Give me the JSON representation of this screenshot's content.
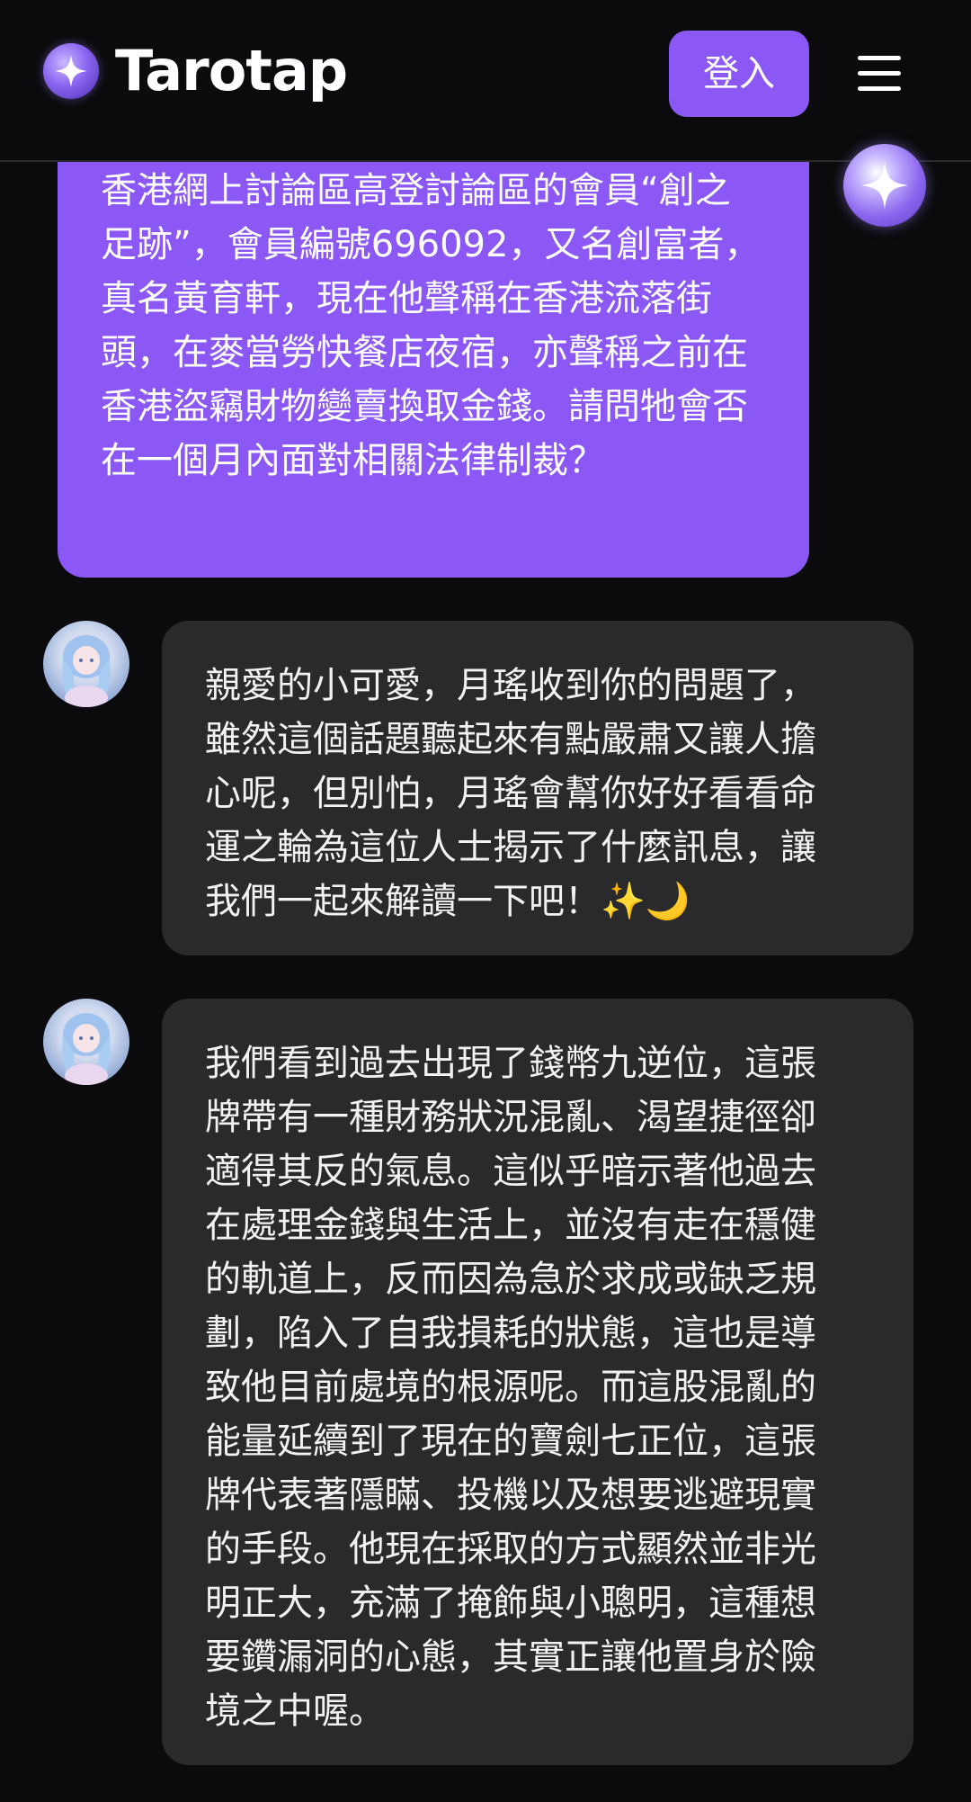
{
  "header": {
    "brand": "Tarotap",
    "login_label": "登入",
    "logo_icon": "sparkle-orb-icon",
    "menu_icon": "hamburger-menu-icon"
  },
  "colors": {
    "background": "#0b0b0d",
    "accent": "#8b57f5",
    "bot_bubble": "#2a2a2c"
  },
  "messages": [
    {
      "role": "user",
      "text": "香港網上討論區高登討論區的會員“創之足跡”，會員編號696092，又名創富者，真名黃育軒，現在他聲稱在香港流落街頭，在麥當勞快餐店夜宿，亦聲稱之前在香港盜竊財物變賣換取金錢。請問牠會否在一個月內面對相關法律制裁？"
    },
    {
      "role": "assistant",
      "text": "親愛的小可愛，月瑤收到你的問題了，雖然這個話題聽起來有點嚴肅又讓人擔心呢，但別怕，月瑤會幫你好好看看命運之輪為這位人士揭示了什麼訊息，讓我們一起來解讀一下吧！✨🌙"
    },
    {
      "role": "assistant",
      "text": "我們看到過去出現了錢幣九逆位，這張牌帶有一種財務狀況混亂、渴望捷徑卻適得其反的氣息。這似乎暗示著他過去在處理金錢與生活上，並沒有走在穩健的軌道上，反而因為急於求成或缺乏規劃，陷入了自我損耗的狀態，這也是導致他目前處境的根源呢。而這股混亂的能量延續到了現在的寶劍七正位，這張牌代表著隱瞞、投機以及想要逃避現實的手段。他現在採取的方式顯然並非光明正大，充滿了掩飾與小聰明，這種想要鑽漏洞的心態，其實正讓他置身於險境之中喔。"
    }
  ]
}
